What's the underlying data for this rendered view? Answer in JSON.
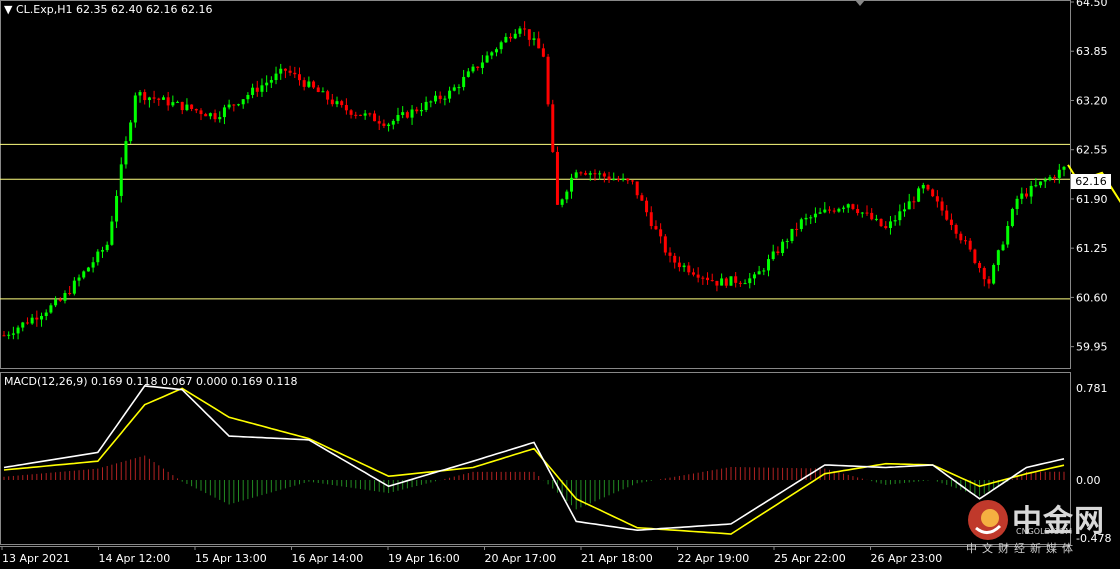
{
  "header": {
    "symbol": "CL.Exp,H1",
    "ohlc": "62.35 62.40 62.16 62.16"
  },
  "macd": {
    "label": "MACD(12,26,9) 0.169 0.118 0.067 0.000 0.169 0.118",
    "axis_top": "0.781",
    "axis_zero": "0.00",
    "axis_bottom": "-0.478"
  },
  "current_price": "62.16",
  "watermark": {
    "name": "中金网",
    "site": "CNGOLD.COM",
    "tag": "中文财经新媒体"
  },
  "colors": {
    "background": "#000000",
    "bull": "#00ff00",
    "bear": "#ff0000",
    "level_line": "#ffff80",
    "macd_line": "#ffffff",
    "signal_line": "#ffff00",
    "hist_up": "#b22222",
    "hist_down": "#228b22",
    "arrow": "#ffff00"
  },
  "chart_data": {
    "type": "line",
    "price_axis": {
      "ticks": [
        "64.50",
        "63.85",
        "63.20",
        "62.55",
        "61.90",
        "61.25",
        "60.60",
        "59.95"
      ],
      "range": [
        59.8,
        64.5
      ]
    },
    "x_ticks": [
      "13 Apr 2021",
      "14 Apr 12:00",
      "15 Apr 13:00",
      "16 Apr 14:00",
      "19 Apr 16:00",
      "20 Apr 17:00",
      "21 Apr 18:00",
      "22 Apr 19:00",
      "25 Apr 22:00",
      "26 Apr 23:00"
    ],
    "horizontal_levels": [
      62.62,
      62.16,
      60.58
    ],
    "price_path": [
      {
        "bar": 0,
        "price": 60.1
      },
      {
        "bar": 12,
        "price": 60.55
      },
      {
        "bar": 22,
        "price": 61.3
      },
      {
        "bar": 28,
        "price": 63.3
      },
      {
        "bar": 45,
        "price": 63.0
      },
      {
        "bar": 60,
        "price": 63.6
      },
      {
        "bar": 72,
        "price": 63.1
      },
      {
        "bar": 82,
        "price": 62.9
      },
      {
        "bar": 95,
        "price": 63.3
      },
      {
        "bar": 110,
        "price": 64.2
      },
      {
        "bar": 115,
        "price": 63.8
      },
      {
        "bar": 118,
        "price": 61.8
      },
      {
        "bar": 122,
        "price": 62.3
      },
      {
        "bar": 134,
        "price": 62.1
      },
      {
        "bar": 142,
        "price": 61.1
      },
      {
        "bar": 152,
        "price": 60.8
      },
      {
        "bar": 160,
        "price": 60.85
      },
      {
        "bar": 170,
        "price": 61.6
      },
      {
        "bar": 180,
        "price": 61.85
      },
      {
        "bar": 188,
        "price": 61.5
      },
      {
        "bar": 196,
        "price": 62.05
      },
      {
        "bar": 202,
        "price": 61.6
      },
      {
        "bar": 210,
        "price": 60.8
      },
      {
        "bar": 216,
        "price": 61.9
      },
      {
        "bar": 226,
        "price": 62.3
      }
    ],
    "macd_path": [
      {
        "bar": 0,
        "macd": 0.1,
        "signal": 0.08
      },
      {
        "bar": 20,
        "macd": 0.22,
        "signal": 0.15
      },
      {
        "bar": 30,
        "macd": 0.75,
        "signal": 0.6
      },
      {
        "bar": 38,
        "macd": 0.72,
        "signal": 0.73
      },
      {
        "bar": 48,
        "macd": 0.35,
        "signal": 0.5
      },
      {
        "bar": 65,
        "macd": 0.32,
        "signal": 0.33
      },
      {
        "bar": 82,
        "macd": -0.05,
        "signal": 0.03
      },
      {
        "bar": 100,
        "macd": 0.15,
        "signal": 0.1
      },
      {
        "bar": 113,
        "macd": 0.3,
        "signal": 0.25
      },
      {
        "bar": 122,
        "macd": -0.33,
        "signal": -0.15
      },
      {
        "bar": 135,
        "macd": -0.4,
        "signal": -0.38
      },
      {
        "bar": 155,
        "macd": -0.35,
        "signal": -0.43
      },
      {
        "bar": 175,
        "macd": 0.12,
        "signal": 0.05
      },
      {
        "bar": 188,
        "macd": 0.1,
        "signal": 0.13
      },
      {
        "bar": 198,
        "macd": 0.12,
        "signal": 0.12
      },
      {
        "bar": 208,
        "macd": -0.15,
        "signal": -0.05
      },
      {
        "bar": 218,
        "macd": 0.1,
        "signal": 0.05
      },
      {
        "bar": 226,
        "macd": 0.169,
        "signal": 0.118
      }
    ]
  }
}
